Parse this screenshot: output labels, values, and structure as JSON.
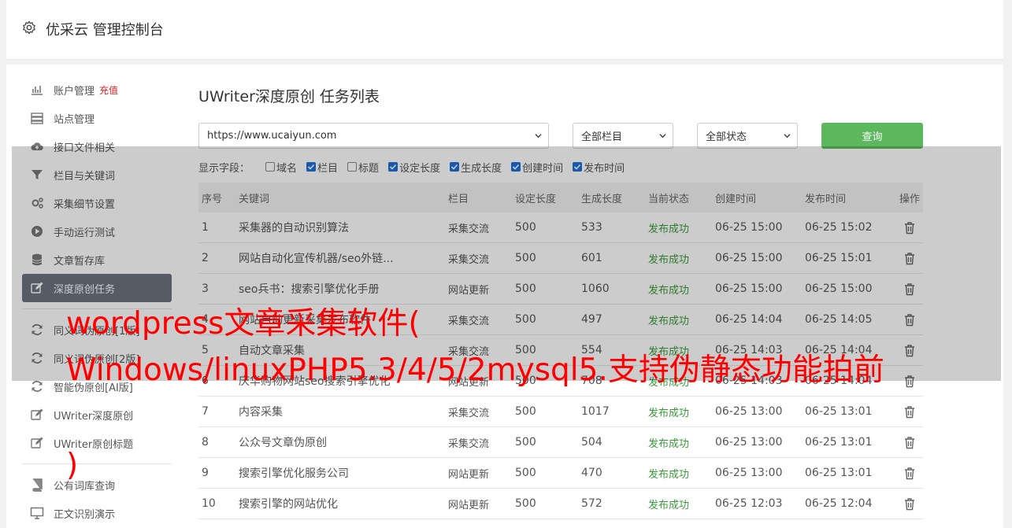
{
  "header": {
    "title": "优采云 管理控制台",
    "icon": "gear-icon"
  },
  "sidebar": {
    "items": [
      {
        "label": "账户管理",
        "extra": "充值",
        "icon": "bar-chart-icon"
      },
      {
        "label": "站点管理",
        "icon": "server-icon"
      },
      {
        "label": "接口文件相关",
        "icon": "cloud-upload-icon"
      },
      {
        "label": "栏目与关键词",
        "icon": "filter-icon"
      },
      {
        "label": "采集细节设置",
        "icon": "gears-icon"
      },
      {
        "label": "手动运行测试",
        "icon": "play-circle-icon"
      },
      {
        "label": "文章暂存库",
        "icon": "database-icon"
      },
      {
        "label": "深度原创任务",
        "icon": "edit-icon",
        "active": true
      },
      {
        "label": "同义词伪原创[1版]",
        "icon": "refresh-icon"
      },
      {
        "label": "同义词伪原创[2版]",
        "icon": "refresh-icon"
      },
      {
        "label": "智能伪原创[AI版]",
        "icon": "refresh-icon"
      },
      {
        "label": "UWriter深度原创",
        "icon": "edit-icon"
      },
      {
        "label": "UWriter原创标题",
        "icon": "edit-icon"
      },
      {
        "label": "公有词库查询",
        "icon": "book-icon"
      },
      {
        "label": "正文识别演示",
        "icon": "monitor-icon"
      }
    ]
  },
  "page": {
    "title": "UWriter深度原创 任务列表"
  },
  "filters": {
    "site": "https://www.ucaiyun.com",
    "column": "全部栏目",
    "status": "全部状态",
    "query_label": "查询",
    "fields_label": "显示字段：",
    "fields": [
      {
        "label": "域名",
        "checked": false
      },
      {
        "label": "栏目",
        "checked": true
      },
      {
        "label": "标题",
        "checked": false
      },
      {
        "label": "设定长度",
        "checked": true
      },
      {
        "label": "生成长度",
        "checked": true
      },
      {
        "label": "创建时间",
        "checked": true
      },
      {
        "label": "发布时间",
        "checked": true
      }
    ]
  },
  "table": {
    "headers": [
      "序号",
      "关键词",
      "栏目",
      "设定长度",
      "生成长度",
      "当前状态",
      "创建时间",
      "发布时间",
      "操作"
    ],
    "rows": [
      {
        "no": "1",
        "keyword": "采集器的自动识别算法",
        "column": "采集交流",
        "set_len": "500",
        "gen_len": "533",
        "status": "发布成功",
        "created": "06-25 15:00",
        "published": "06-25 15:02"
      },
      {
        "no": "2",
        "keyword": "网站自动化宣传机器/seo外链...",
        "column": "采集交流",
        "set_len": "500",
        "gen_len": "601",
        "status": "发布成功",
        "created": "06-25 15:00",
        "published": "06-25 15:01"
      },
      {
        "no": "3",
        "keyword": "seo兵书：搜索引擎优化手册",
        "column": "网站更新",
        "set_len": "500",
        "gen_len": "1060",
        "status": "发布成功",
        "created": "06-25 15:00",
        "published": "06-25 15:00"
      },
      {
        "no": "4",
        "keyword": "网站自动更新采集发布软件",
        "column": "采集交流",
        "set_len": "500",
        "gen_len": "497",
        "status": "发布成功",
        "created": "06-25 14:04",
        "published": "06-25 14:05"
      },
      {
        "no": "5",
        "keyword": "自动文章采集",
        "column": "采集交流",
        "set_len": "500",
        "gen_len": "554",
        "status": "发布成功",
        "created": "06-25 14:03",
        "published": "06-25 14:04"
      },
      {
        "no": "6",
        "keyword": "庆华购物网站seo搜索引擎优化",
        "column": "网站更新",
        "set_len": "500",
        "gen_len": "708",
        "status": "发布成功",
        "created": "06-25 14:03",
        "published": "06-25 14:04"
      },
      {
        "no": "7",
        "keyword": "内容采集",
        "column": "采集交流",
        "set_len": "500",
        "gen_len": "1017",
        "status": "发布成功",
        "created": "06-25 13:00",
        "published": "06-25 13:01"
      },
      {
        "no": "8",
        "keyword": "公众号文章伪原创",
        "column": "采集交流",
        "set_len": "500",
        "gen_len": "504",
        "status": "发布成功",
        "created": "06-25 13:00",
        "published": "06-25 13:01"
      },
      {
        "no": "9",
        "keyword": "搜索引擎优化服务公司",
        "column": "网站更新",
        "set_len": "500",
        "gen_len": "470",
        "status": "发布成功",
        "created": "06-25 13:00",
        "published": "06-25 13:01"
      },
      {
        "no": "10",
        "keyword": "搜索引擎的网站优化",
        "column": "网站更新",
        "set_len": "500",
        "gen_len": "572",
        "status": "发布成功",
        "created": "06-25 12:03",
        "published": "06-25 12:04"
      }
    ]
  },
  "overlay": {
    "line1": "wordpress文章采集软件(",
    "line2": "Windows/linuxPHP5.3/4/5/2mysql5.支持伪静态功能拍前",
    "line3": ")"
  },
  "colors": {
    "active_bg": "#6c7280",
    "query_btn": "#5cb85c",
    "status_green": "#3a9a3a",
    "overlay_text": "#ff0000",
    "checkbox_on": "#1e6fd9"
  }
}
